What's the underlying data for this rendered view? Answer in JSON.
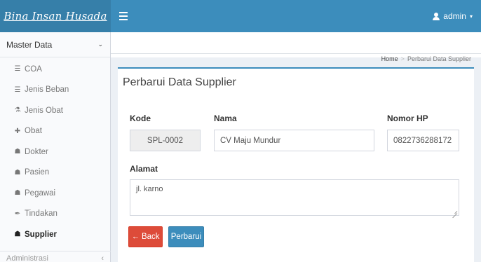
{
  "app": {
    "brand": "Bina Insan Husada"
  },
  "topbar": {
    "user_label": "admin",
    "user_caret": "▾"
  },
  "sidebar": {
    "section_label": "Master Data",
    "section_chevron": "⌄",
    "items": [
      {
        "label": "COA",
        "icon": "list-icon",
        "glyph": "☰",
        "active": false
      },
      {
        "label": "Jenis Beban",
        "icon": "list-icon",
        "glyph": "☰",
        "active": false
      },
      {
        "label": "Jenis Obat",
        "icon": "flask-icon",
        "glyph": "⚗",
        "active": false
      },
      {
        "label": "Obat",
        "icon": "medicine-icon",
        "glyph": "✚",
        "active": false
      },
      {
        "label": "Dokter",
        "icon": "user-md-icon",
        "glyph": "☗",
        "active": false
      },
      {
        "label": "Pasien",
        "icon": "patient-icon",
        "glyph": "☗",
        "active": false
      },
      {
        "label": "Pegawai",
        "icon": "user-icon",
        "glyph": "☗",
        "active": false
      },
      {
        "label": "Tindakan",
        "icon": "syringe-icon",
        "glyph": "✒",
        "active": false
      },
      {
        "label": "Supplier",
        "icon": "supplier-icon",
        "glyph": "☗",
        "active": true
      }
    ],
    "next_section_label": "Administrasi",
    "next_section_chevron": "‹"
  },
  "breadcrumb": {
    "home": "Home",
    "separator": ">",
    "current": "Perbarui Data Supplier"
  },
  "form": {
    "title": "Perbarui Data Supplier",
    "kode_label": "Kode",
    "kode_value": "SPL-0002",
    "nama_label": "Nama",
    "nama_value": "CV Maju Mundur",
    "hp_label": "Nomor HP",
    "hp_value": "0822736288172",
    "alamat_label": "Alamat",
    "alamat_value": "jl. karno",
    "back_label": "Back",
    "back_arrow": "←",
    "save_label": "Perbarui"
  },
  "colors": {
    "topbar": "#3c8dbc",
    "brand_bg": "#367fa9",
    "back_button": "#dd4b39",
    "save_button": "#3c8dbc"
  }
}
